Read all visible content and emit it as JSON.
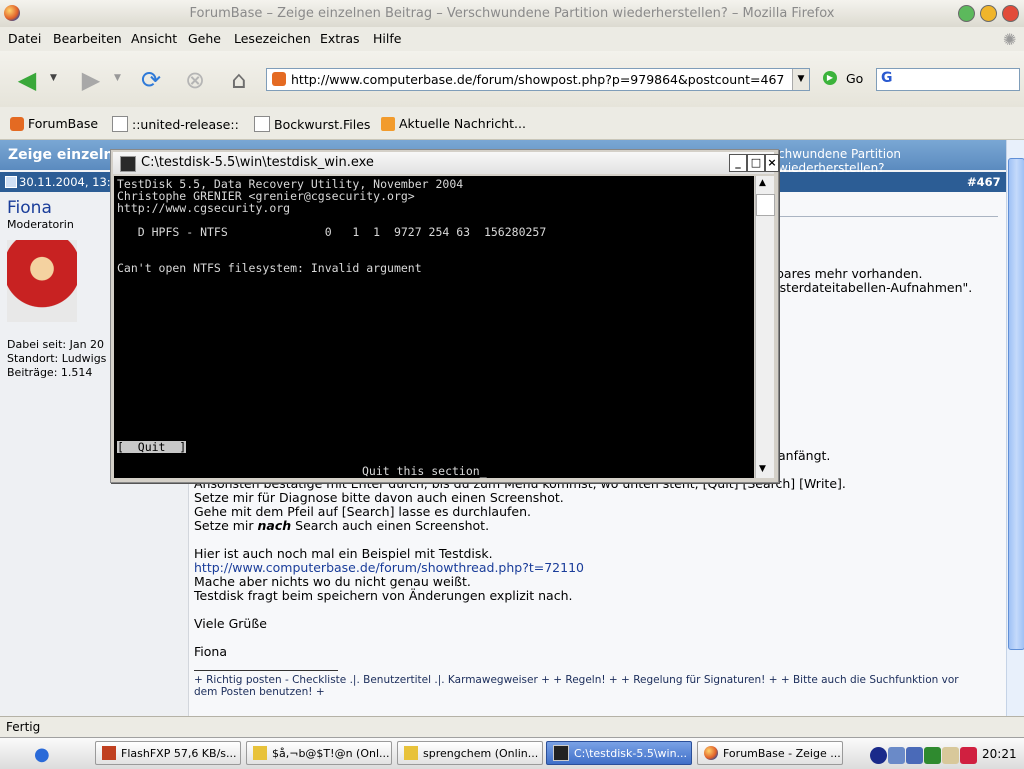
{
  "window": {
    "title": "ForumBase – Zeige einzelnen Beitrag – Verschwundene Partition wiederherstellen? – Mozilla Firefox",
    "button_colors": [
      "#5cb95c",
      "#f0b52b",
      "#e24b3a"
    ]
  },
  "menu": [
    "Datei",
    "Bearbeiten",
    "Ansicht",
    "Gehe",
    "Lesezeichen",
    "Extras",
    "Hilfe"
  ],
  "navbar": {
    "url": "http://www.computerbase.de/forum/showpost.php?p=979864&postcount=467",
    "go_label": "Go",
    "search_value": ""
  },
  "bookmarks": [
    "ForumBase",
    "::united-release::",
    "Bockwurst.Files",
    "Aktuelle Nachricht..."
  ],
  "page": {
    "forum_title": "Zeige einzelne",
    "forum_title_right": "chwundene Partition wiederherstellen?",
    "post_date": "30.11.2004, 13:",
    "post_number": "#467",
    "user": {
      "name": "Fiona",
      "rank": "Moderatorin",
      "joined": "Dabei seit: Jan 20",
      "location": "Standort: Ludwigs",
      "posts": "Beiträge: 1.514"
    },
    "partial_lines": [
      "bares mehr vorhanden.",
      "asterdateitabellen-Aufnahmen\".",
      "anfängt."
    ],
    "body_lines": [
      "Ansonsten bestätige mit Enter durch, bis du zum Menü kommst, wo unten steht, [Quit] [Search] [Write].",
      "Setze mir für Diagnose bitte davon auch einen Screenshot.",
      "Gehe mit dem Pfeil auf [Search] lasse es durchlaufen.",
      "Setze mir",
      "nach",
      "Search auch einen Screenshot.",
      "Hier ist auch noch mal ein Beispiel mit Testdisk.",
      "http://www.computerbase.de/forum/showthread.php?t=72110",
      "Mache aber nichts wo du nicht genau weißt.",
      "Testdisk fragt beim speichern von Änderungen explizit nach.",
      "Viele Grüße",
      "Fiona"
    ],
    "signature": {
      "line1": "+ Richtig posten - Checkliste .|. Benutzertitel .|. Karmawegweiser + + Regeln! + + Regelung für Signaturen! + + Bitte auch die Suchfunktion vor",
      "line2": "dem Posten benutzen! +"
    }
  },
  "status": "Fertig",
  "console": {
    "title": "C:\\testdisk-5.5\\win\\testdisk_win.exe",
    "lines": [
      "TestDisk 5.5, Data Recovery Utility, November 2004",
      "Christophe GRENIER <grenier@cgsecurity.org>",
      "http://www.cgsecurity.org",
      "   D HPFS - NTFS              0   1  1  9727 254 63  156280257",
      "Can't open NTFS filesystem: Invalid argument",
      "[  Quit  ]",
      "Quit this section_"
    ]
  },
  "taskbar": {
    "tasks": [
      "FlashFXP 57,6 KB/s...",
      "$å,¬b@$T!@n (Onl...",
      "sprengchem (Onlin...",
      "C:\\testdisk-5.5\\win...",
      "ForumBase - Zeige ..."
    ],
    "clock": "20:21"
  }
}
